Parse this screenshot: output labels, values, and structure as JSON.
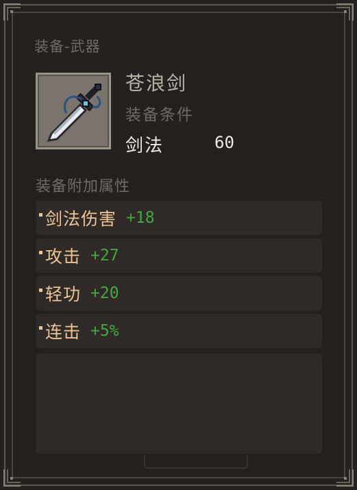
{
  "category": "装备-武器",
  "item": {
    "name": "苍浪剑",
    "icon": "sword-icon",
    "requirement_title": "装备条件",
    "requirement": {
      "name": "剑法",
      "value": "60"
    }
  },
  "attributes_title": "装备附加属性",
  "attributes": [
    {
      "name": "剑法伤害",
      "value": "+18"
    },
    {
      "name": "攻击",
      "value": "+27"
    },
    {
      "name": "轻功",
      "value": "+20"
    },
    {
      "name": "连击",
      "value": "+5%"
    }
  ],
  "colors": {
    "attr_name": "#ecc596",
    "attr_value": "#43a83f",
    "muted": "#6f6a64",
    "panel": "#24201d"
  }
}
